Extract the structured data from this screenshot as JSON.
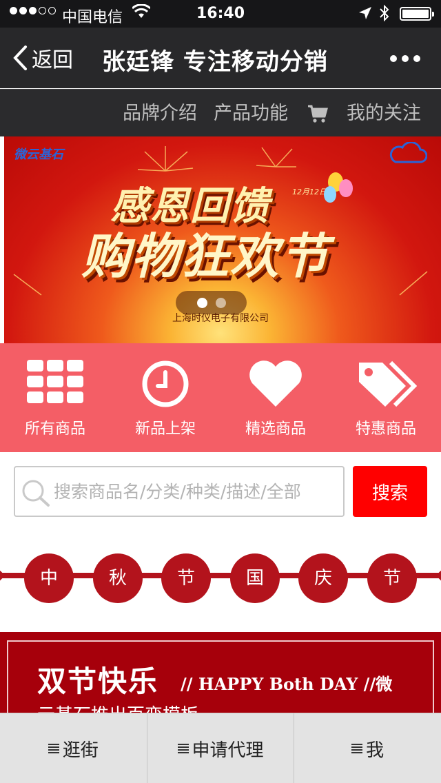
{
  "status_bar": {
    "carrier": "中国电信",
    "time": "16:40"
  },
  "nav": {
    "back_label": "返回",
    "title": "张廷锋 专注移动分销"
  },
  "submenu": {
    "items": [
      "品牌介绍",
      "产品功能"
    ],
    "follow_label": "我的关注"
  },
  "banner": {
    "brand": "微云基石",
    "headline_1": "感恩回馈",
    "headline_2": "购物狂欢节",
    "date_tag": "12月12日",
    "company": "上海时仪电子有限公司",
    "slide_count": 2,
    "active_slide": 1
  },
  "categories": [
    {
      "label": "所有商品",
      "icon": "grid-icon"
    },
    {
      "label": "新品上架",
      "icon": "clock-icon"
    },
    {
      "label": "精选商品",
      "icon": "heart-icon"
    },
    {
      "label": "特惠商品",
      "icon": "tag-icon"
    }
  ],
  "search": {
    "placeholder": "搜索商品名/分类/种类/描述/全部",
    "button_label": "搜索"
  },
  "festival": {
    "chars": [
      "中",
      "秋",
      "节",
      "国",
      "庆",
      "节"
    ]
  },
  "holiday": {
    "title": "双节快乐",
    "subtitle": "// HAPPY Both DAY //微",
    "line2": "云基石推出百变模板"
  },
  "tabbar": {
    "tabs": [
      "逛街",
      "申请代理",
      "我"
    ]
  },
  "colors": {
    "category_bg": "#f45e66",
    "festival_red": "#b3131c",
    "search_button": "#ff0000",
    "holiday_bg": "#a6000b"
  }
}
